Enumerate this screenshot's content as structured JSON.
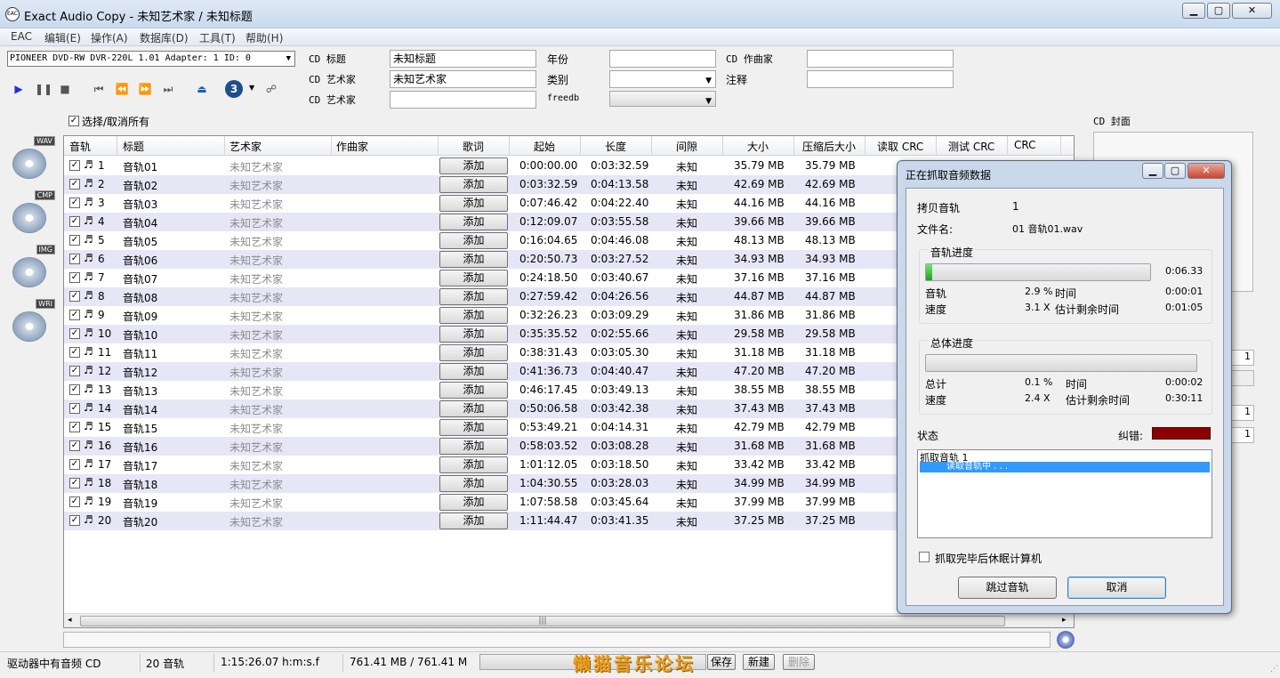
{
  "window": {
    "title": "Exact Audio Copy  -  未知艺术家 / 未知标题",
    "icon_text": "EAC",
    "caption_buttons": [
      "minimize-icon",
      "maximize-icon",
      "close-icon"
    ]
  },
  "menu": [
    "EAC",
    "编辑(E)",
    "操作(A)",
    "数据库(D)",
    "工具(T)",
    "帮助(H)"
  ],
  "drive": {
    "selected": "PIONEER DVD-RW  DVR-220L 1.01   Adapter: 1  ID: 0"
  },
  "cd_info": {
    "title_label": "CD 标题",
    "title_value": "未知标题",
    "artist_label": "CD 艺术家",
    "artist_value": "未知艺术家",
    "artist2_label": "CD 艺术家",
    "artist2_value": "",
    "year_label": "年份",
    "year_value": "",
    "genre_label": "类别",
    "genre_value": "",
    "freedb_label": "freedb",
    "freedb_value": "",
    "composer_label": "CD 作曲家",
    "composer_value": "",
    "comment_label": "注释",
    "comment_value": ""
  },
  "toolbar": {
    "session_number": "3"
  },
  "select_all_label": "选择/取消所有",
  "side_buttons": [
    "WAV",
    "CMP",
    "IMG",
    "WRI"
  ],
  "cover_label": "CD 封面",
  "columns": [
    "音轨",
    "标题",
    "艺术家",
    "作曲家",
    "歌词",
    "起始",
    "长度",
    "间隙",
    "大小",
    "压缩后大小",
    "读取 CRC",
    "测试 CRC",
    "CRC"
  ],
  "add_label": "添加",
  "tracks": [
    {
      "n": "1",
      "title": "音轨01",
      "artist": "未知艺术家",
      "start": "0:00:00.00",
      "len": "0:03:32.59",
      "gap": "未知",
      "size": "35.79 MB",
      "csize": "35.79 MB"
    },
    {
      "n": "2",
      "title": "音轨02",
      "artist": "未知艺术家",
      "start": "0:03:32.59",
      "len": "0:04:13.58",
      "gap": "未知",
      "size": "42.69 MB",
      "csize": "42.69 MB"
    },
    {
      "n": "3",
      "title": "音轨03",
      "artist": "未知艺术家",
      "start": "0:07:46.42",
      "len": "0:04:22.40",
      "gap": "未知",
      "size": "44.16 MB",
      "csize": "44.16 MB"
    },
    {
      "n": "4",
      "title": "音轨04",
      "artist": "未知艺术家",
      "start": "0:12:09.07",
      "len": "0:03:55.58",
      "gap": "未知",
      "size": "39.66 MB",
      "csize": "39.66 MB"
    },
    {
      "n": "5",
      "title": "音轨05",
      "artist": "未知艺术家",
      "start": "0:16:04.65",
      "len": "0:04:46.08",
      "gap": "未知",
      "size": "48.13 MB",
      "csize": "48.13 MB"
    },
    {
      "n": "6",
      "title": "音轨06",
      "artist": "未知艺术家",
      "start": "0:20:50.73",
      "len": "0:03:27.52",
      "gap": "未知",
      "size": "34.93 MB",
      "csize": "34.93 MB"
    },
    {
      "n": "7",
      "title": "音轨07",
      "artist": "未知艺术家",
      "start": "0:24:18.50",
      "len": "0:03:40.67",
      "gap": "未知",
      "size": "37.16 MB",
      "csize": "37.16 MB"
    },
    {
      "n": "8",
      "title": "音轨08",
      "artist": "未知艺术家",
      "start": "0:27:59.42",
      "len": "0:04:26.56",
      "gap": "未知",
      "size": "44.87 MB",
      "csize": "44.87 MB"
    },
    {
      "n": "9",
      "title": "音轨09",
      "artist": "未知艺术家",
      "start": "0:32:26.23",
      "len": "0:03:09.29",
      "gap": "未知",
      "size": "31.86 MB",
      "csize": "31.86 MB"
    },
    {
      "n": "10",
      "title": "音轨10",
      "artist": "未知艺术家",
      "start": "0:35:35.52",
      "len": "0:02:55.66",
      "gap": "未知",
      "size": "29.58 MB",
      "csize": "29.58 MB"
    },
    {
      "n": "11",
      "title": "音轨11",
      "artist": "未知艺术家",
      "start": "0:38:31.43",
      "len": "0:03:05.30",
      "gap": "未知",
      "size": "31.18 MB",
      "csize": "31.18 MB"
    },
    {
      "n": "12",
      "title": "音轨12",
      "artist": "未知艺术家",
      "start": "0:41:36.73",
      "len": "0:04:40.47",
      "gap": "未知",
      "size": "47.20 MB",
      "csize": "47.20 MB"
    },
    {
      "n": "13",
      "title": "音轨13",
      "artist": "未知艺术家",
      "start": "0:46:17.45",
      "len": "0:03:49.13",
      "gap": "未知",
      "size": "38.55 MB",
      "csize": "38.55 MB"
    },
    {
      "n": "14",
      "title": "音轨14",
      "artist": "未知艺术家",
      "start": "0:50:06.58",
      "len": "0:03:42.38",
      "gap": "未知",
      "size": "37.43 MB",
      "csize": "37.43 MB"
    },
    {
      "n": "15",
      "title": "音轨15",
      "artist": "未知艺术家",
      "start": "0:53:49.21",
      "len": "0:04:14.31",
      "gap": "未知",
      "size": "42.79 MB",
      "csize": "42.79 MB"
    },
    {
      "n": "16",
      "title": "音轨16",
      "artist": "未知艺术家",
      "start": "0:58:03.52",
      "len": "0:03:08.28",
      "gap": "未知",
      "size": "31.68 MB",
      "csize": "31.68 MB"
    },
    {
      "n": "17",
      "title": "音轨17",
      "artist": "未知艺术家",
      "start": "1:01:12.05",
      "len": "0:03:18.50",
      "gap": "未知",
      "size": "33.42 MB",
      "csize": "33.42 MB"
    },
    {
      "n": "18",
      "title": "音轨18",
      "artist": "未知艺术家",
      "start": "1:04:30.55",
      "len": "0:03:28.03",
      "gap": "未知",
      "size": "34.99 MB",
      "csize": "34.99 MB"
    },
    {
      "n": "19",
      "title": "音轨19",
      "artist": "未知艺术家",
      "start": "1:07:58.58",
      "len": "0:03:45.64",
      "gap": "未知",
      "size": "37.99 MB",
      "csize": "37.99 MB"
    },
    {
      "n": "20",
      "title": "音轨20",
      "artist": "未知艺术家",
      "start": "1:11:44.47",
      "len": "0:03:41.35",
      "gap": "未知",
      "size": "37.25 MB",
      "csize": "37.25 MB"
    }
  ],
  "status": {
    "drive_state": "驱动器中有音频 CD",
    "track_count": "20 音轨",
    "total_time": "1:15:26.07 h:m:s.f",
    "total_size": "761.41 MB / 761.41 M",
    "save": "保存",
    "new": "新建",
    "delete": "删除"
  },
  "right_panel_numbers": [
    "1",
    "1",
    "1"
  ],
  "dialog": {
    "title": "正在抓取音频数据",
    "copy_track_label": "拷贝音轨",
    "copy_track_value": "1",
    "filename_label": "文件名:",
    "filename_value": "01 音轨01.wav",
    "track_group": "音轨进度",
    "track_progress": 0.029,
    "track_time_right": "0:06.33",
    "track_label": "音轨",
    "track_pct": "2.9 %",
    "time_label": "时间",
    "track_time": "0:00:01",
    "speed_label": "速度",
    "track_speed": "3.1 X",
    "remain_label": "估计剩余时间",
    "track_remain": "0:01:05",
    "total_group": "总体进度",
    "total_progress": 0.001,
    "total_label": "总计",
    "total_pct": "0.1 %",
    "total_time": "0:00:02",
    "total_speed": "2.4 X",
    "total_remain": "0:30:11",
    "status_label": "状态",
    "error_label": "纠错:",
    "status_line1": "抓取音轨   1",
    "status_line2": "读取音轨中 . . .",
    "hibernate_label": "抓取完毕后休眠计算机",
    "skip_button": "跳过音轨",
    "cancel_button": "取消"
  },
  "watermark": "懒猫音乐论坛",
  "colors": {
    "row_alt": "#e6e6f6",
    "progress_green": "#21a121",
    "selection": "#3399ff",
    "error_meter": "#8b0000"
  }
}
